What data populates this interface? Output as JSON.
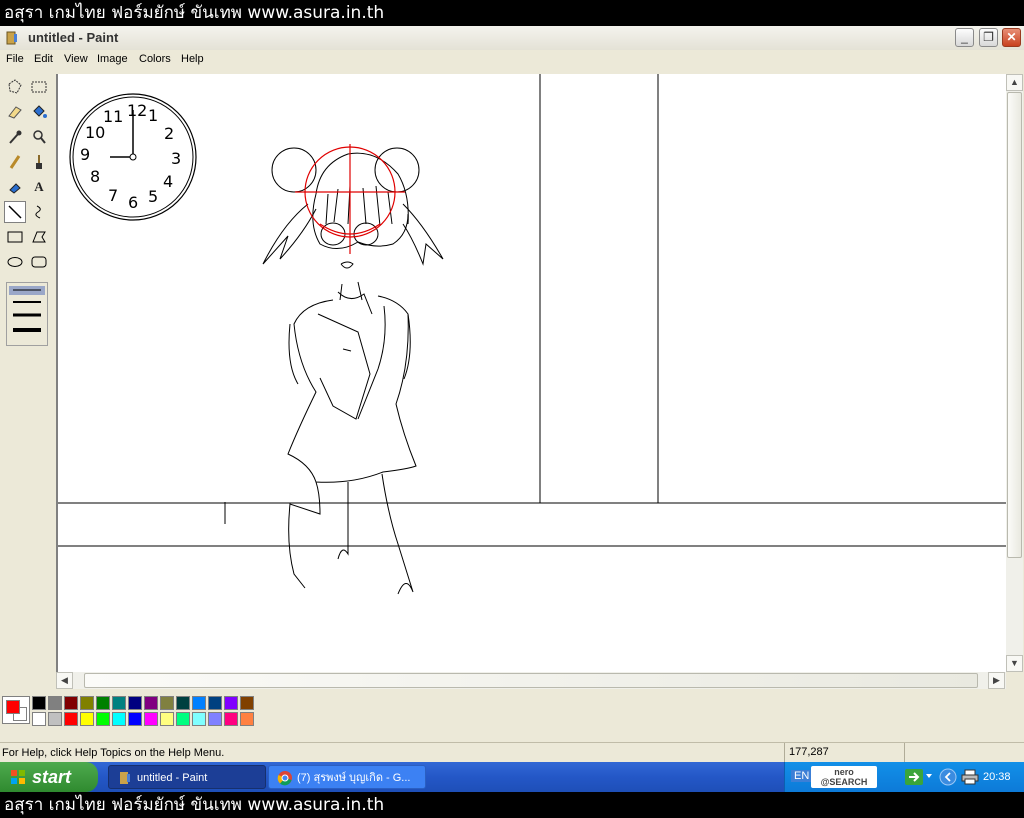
{
  "banner": {
    "text": "อสุรา เกมไทย ฟอร์มยักษ์ ขันเทพ www.asura.in.th"
  },
  "window": {
    "title": "untitled - Paint",
    "controls": {
      "minimize": "_",
      "restore": "❐",
      "close": "✕"
    }
  },
  "menu": {
    "items": [
      "File",
      "Edit",
      "View",
      "Image",
      "Colors",
      "Help"
    ]
  },
  "tools": [
    {
      "icon": "free-form-select-icon"
    },
    {
      "icon": "rect-select-icon"
    },
    {
      "icon": "eraser-icon"
    },
    {
      "icon": "fill-icon"
    },
    {
      "icon": "pick-color-icon"
    },
    {
      "icon": "magnifier-icon"
    },
    {
      "icon": "pencil-icon"
    },
    {
      "icon": "brush-icon"
    },
    {
      "icon": "airbrush-icon"
    },
    {
      "icon": "text-icon",
      "glyph": "A"
    },
    {
      "icon": "line-icon",
      "active": true
    },
    {
      "icon": "curve-icon"
    },
    {
      "icon": "rectangle-icon"
    },
    {
      "icon": "polygon-icon"
    },
    {
      "icon": "ellipse-icon"
    },
    {
      "icon": "rounded-rect-icon"
    }
  ],
  "colors": {
    "foreground": "#ff0000",
    "background": "#ffffff",
    "palette_top": [
      "#000000",
      "#808080",
      "#800000",
      "#808000",
      "#008000",
      "#008080",
      "#000080",
      "#800080",
      "#808040",
      "#004040",
      "#0080ff",
      "#004080",
      "#8000ff",
      "#804000"
    ],
    "palette_bottom": [
      "#ffffff",
      "#c0c0c0",
      "#ff0000",
      "#ffff00",
      "#00ff00",
      "#00ffff",
      "#0000ff",
      "#ff00ff",
      "#ffff80",
      "#00ff80",
      "#80ffff",
      "#8080ff",
      "#ff0080",
      "#ff8040"
    ]
  },
  "canvas": {
    "clock_numerals": [
      "12",
      "1",
      "2",
      "3",
      "4",
      "5",
      "6",
      "7",
      "8",
      "9",
      "10",
      "11"
    ]
  },
  "status": {
    "help": "For Help, click Help Topics on the Help Menu.",
    "coords": "177,287"
  },
  "taskbar": {
    "start": "start",
    "items": [
      {
        "label": "untitled - Paint",
        "active": true
      },
      {
        "label": "(7) สุรพงษ์ บุญเกิด - G...",
        "active": false
      }
    ],
    "tray": {
      "lang": "EN",
      "nero": "nero",
      "nero_sub": "@SEARCH",
      "time": "20:38"
    }
  }
}
